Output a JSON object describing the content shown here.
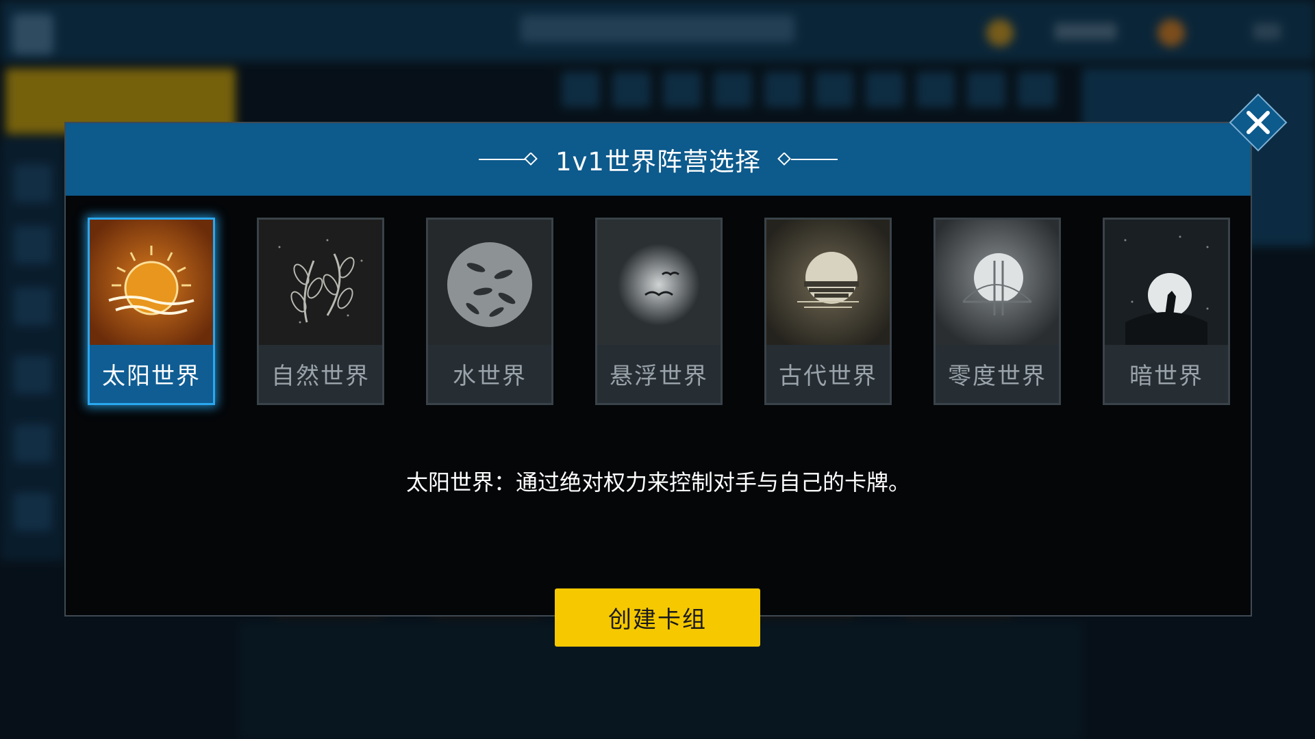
{
  "modal": {
    "title": "1v1世界阵营选择",
    "close_label": "×"
  },
  "factions": [
    {
      "label": "太阳世界",
      "icon": "sun-icon",
      "selected": true
    },
    {
      "label": "自然世界",
      "icon": "leaves-icon",
      "selected": false
    },
    {
      "label": "水世界",
      "icon": "fish-icon",
      "selected": false
    },
    {
      "label": "悬浮世界",
      "icon": "birds-icon",
      "selected": false
    },
    {
      "label": "古代世界",
      "icon": "temple-icon",
      "selected": false
    },
    {
      "label": "零度世界",
      "icon": "bridge-moon-icon",
      "selected": false
    },
    {
      "label": "暗世界",
      "icon": "wolf-moon-icon",
      "selected": false
    }
  ],
  "description": "太阳世界：通过绝对权力来控制对手与自己的卡牌。",
  "create_button": "创建卡组",
  "colors": {
    "header_blue": "#0d5a8c",
    "selected_border": "#2aa8f0",
    "button_yellow": "#f5c800",
    "sun_orange": "#c8631a"
  }
}
